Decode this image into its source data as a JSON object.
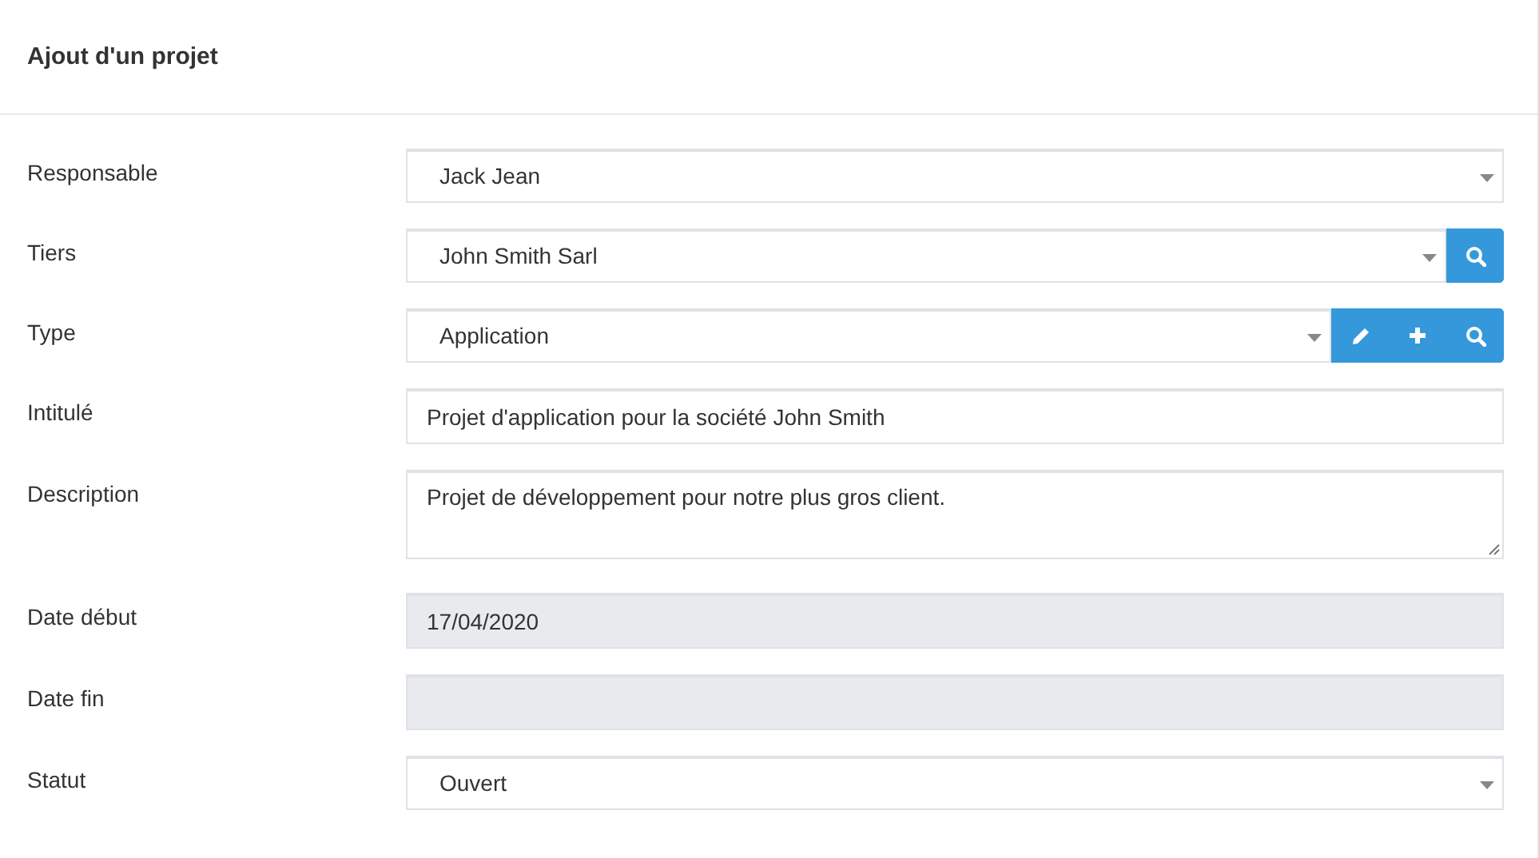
{
  "title": "Ajout d'un projet",
  "fields": [
    {
      "label": "Responsable",
      "kind": "select",
      "value": "Jack Jean"
    },
    {
      "label": "Tiers",
      "kind": "select",
      "value": "John Smith Sarl",
      "buttons": [
        {
          "kind": "search"
        }
      ]
    },
    {
      "label": "Type",
      "kind": "select",
      "value": "Application",
      "buttons": [
        {
          "kind": "edit"
        },
        {
          "kind": "add"
        },
        {
          "kind": "search"
        }
      ]
    },
    {
      "label": "Intitulé",
      "kind": "input",
      "value": "Projet d'application pour la société John Smith",
      "disabled": false
    },
    {
      "label": "Description",
      "kind": "textarea",
      "value": "Projet de développement pour notre plus gros client."
    },
    {
      "label": "Date début",
      "kind": "input",
      "value": "17/04/2020",
      "disabled": true
    },
    {
      "label": "Date fin",
      "kind": "input",
      "disabled": true
    },
    {
      "label": "Statut",
      "kind": "select",
      "value": "Ouvert"
    }
  ]
}
